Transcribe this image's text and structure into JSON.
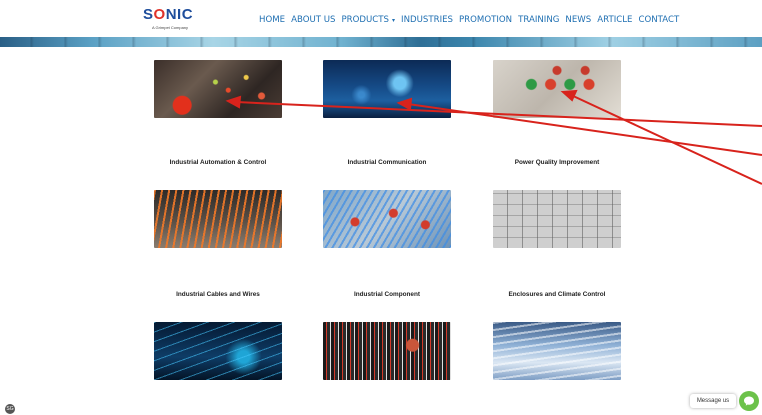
{
  "logo": {
    "name": "S",
    "name_o": "O",
    "name_end": "NIC",
    "tagline": "A Grimpet Company"
  },
  "nav": {
    "items": [
      {
        "label": "HOME"
      },
      {
        "label": "ABOUT US"
      },
      {
        "label": "PRODUCTS"
      },
      {
        "label": "INDUSTRIES"
      },
      {
        "label": "PROMOTION"
      },
      {
        "label": "TRAINING"
      },
      {
        "label": "NEWS"
      },
      {
        "label": "ARTICLE"
      },
      {
        "label": "CONTACT"
      }
    ],
    "products_caret": "▾"
  },
  "products": [
    {
      "label": "Industrial Automation & Control"
    },
    {
      "label": "Industrial Communication"
    },
    {
      "label": "Power Quality Improvement"
    },
    {
      "label": "Industrial Cables and Wires"
    },
    {
      "label": "Industrial Component"
    },
    {
      "label": "Enclosures and Climate Control"
    }
  ],
  "chat": {
    "label": "Message us",
    "icon": "chat-bubble-icon"
  },
  "corner": {
    "icon": "accessibility-icon",
    "text": "SG"
  },
  "colors": {
    "nav": "#1f6fb2",
    "annotation": "#d8231c",
    "chat": "#6cc24a",
    "logo_blue": "#1f4e9c",
    "logo_red": "#e0332b"
  }
}
